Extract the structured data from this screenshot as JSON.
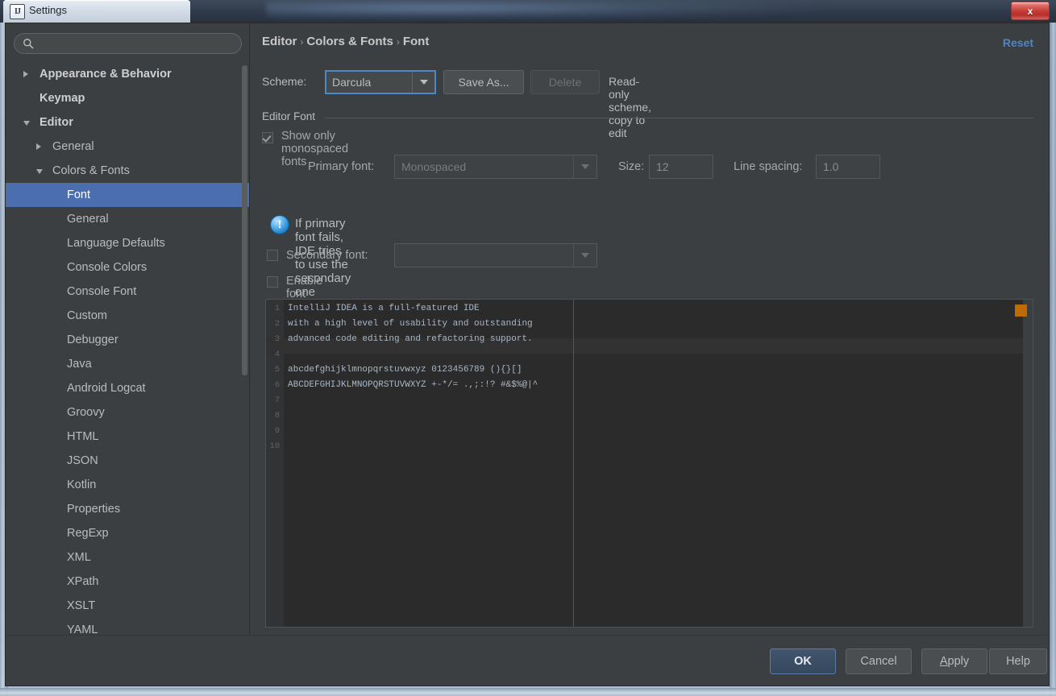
{
  "window": {
    "title": "Settings",
    "app_icon": "intellij-idea-icon",
    "close_label": "x"
  },
  "sidebar": {
    "search": {
      "value": "",
      "placeholder": ""
    },
    "items": [
      {
        "label": "Appearance & Behavior",
        "level": 0,
        "arrow": "collapsed",
        "bold": true,
        "selected": false
      },
      {
        "label": "Keymap",
        "level": 0,
        "arrow": "none",
        "bold": true,
        "selected": false
      },
      {
        "label": "Editor",
        "level": 0,
        "arrow": "expanded",
        "bold": true,
        "selected": false
      },
      {
        "label": "General",
        "level": 1,
        "arrow": "collapsed",
        "bold": false,
        "selected": false
      },
      {
        "label": "Colors & Fonts",
        "level": 1,
        "arrow": "expanded",
        "bold": false,
        "selected": false
      },
      {
        "label": "Font",
        "level": 2,
        "arrow": "none",
        "bold": false,
        "selected": true
      },
      {
        "label": "General",
        "level": 2,
        "arrow": "none",
        "bold": false,
        "selected": false
      },
      {
        "label": "Language Defaults",
        "level": 2,
        "arrow": "none",
        "bold": false,
        "selected": false
      },
      {
        "label": "Console Colors",
        "level": 2,
        "arrow": "none",
        "bold": false,
        "selected": false
      },
      {
        "label": "Console Font",
        "level": 2,
        "arrow": "none",
        "bold": false,
        "selected": false
      },
      {
        "label": "Custom",
        "level": 2,
        "arrow": "none",
        "bold": false,
        "selected": false
      },
      {
        "label": "Debugger",
        "level": 2,
        "arrow": "none",
        "bold": false,
        "selected": false
      },
      {
        "label": "Java",
        "level": 2,
        "arrow": "none",
        "bold": false,
        "selected": false
      },
      {
        "label": "Android Logcat",
        "level": 2,
        "arrow": "none",
        "bold": false,
        "selected": false
      },
      {
        "label": "Groovy",
        "level": 2,
        "arrow": "none",
        "bold": false,
        "selected": false
      },
      {
        "label": "HTML",
        "level": 2,
        "arrow": "none",
        "bold": false,
        "selected": false
      },
      {
        "label": "JSON",
        "level": 2,
        "arrow": "none",
        "bold": false,
        "selected": false
      },
      {
        "label": "Kotlin",
        "level": 2,
        "arrow": "none",
        "bold": false,
        "selected": false
      },
      {
        "label": "Properties",
        "level": 2,
        "arrow": "none",
        "bold": false,
        "selected": false
      },
      {
        "label": "RegExp",
        "level": 2,
        "arrow": "none",
        "bold": false,
        "selected": false
      },
      {
        "label": "XML",
        "level": 2,
        "arrow": "none",
        "bold": false,
        "selected": false
      },
      {
        "label": "XPath",
        "level": 2,
        "arrow": "none",
        "bold": false,
        "selected": false
      },
      {
        "label": "XSLT",
        "level": 2,
        "arrow": "none",
        "bold": false,
        "selected": false
      },
      {
        "label": "YAML",
        "level": 2,
        "arrow": "none",
        "bold": false,
        "selected": false
      }
    ]
  },
  "header": {
    "breadcrumb": [
      "Editor",
      "Colors & Fonts",
      "Font"
    ],
    "separator": "›",
    "reset_label": "Reset"
  },
  "scheme": {
    "label": "Scheme:",
    "value": "Darcula",
    "save_as_label": "Save As...",
    "delete_label": "Delete",
    "readonly_note": "Read-only scheme, copy to edit"
  },
  "editor_font": {
    "group_title": "Editor Font",
    "monospaced_label": "Show only monospaced fonts",
    "monospaced_checked": true,
    "primary_font_label": "Primary font:",
    "primary_font_value": "Monospaced",
    "size_label": "Size:",
    "size_value": "12",
    "line_spacing_label": "Line spacing:",
    "line_spacing_value": "1.0",
    "info_icon": "info-exclamation-icon",
    "info_text": "If primary font fails, IDE tries to use the secondary one",
    "secondary_font_label": "Secondary font:",
    "secondary_font_value": "",
    "secondary_checked": false,
    "ligatures_label": "Enable font ligatures more info",
    "ligatures_checked": false
  },
  "preview": {
    "caret_line": 4,
    "marker_color": "#bf6b04",
    "lines": [
      {
        "n": "1",
        "text": "IntelliJ IDEA is a full-featured IDE"
      },
      {
        "n": "2",
        "text": "with a high level of usability and outstanding"
      },
      {
        "n": "3",
        "text": "advanced code editing and refactoring support."
      },
      {
        "n": "4",
        "text": ""
      },
      {
        "n": "5",
        "text": "abcdefghijklmnopqrstuvwxyz 0123456789 (){}[]"
      },
      {
        "n": "6",
        "text": "ABCDEFGHIJKLMNOPQRSTUVWXYZ +-*/= .,;:!? #&$%@|^"
      },
      {
        "n": "7",
        "text": ""
      },
      {
        "n": "8",
        "text": ""
      },
      {
        "n": "9",
        "text": ""
      },
      {
        "n": "10",
        "text": ""
      }
    ]
  },
  "footer": {
    "ok_label": "OK",
    "cancel_label": "Cancel",
    "apply_label": "Apply",
    "apply_mnemonic": "A",
    "apply_rest": "pply",
    "help_label": "Help"
  },
  "colors": {
    "accent_selection": "#4b6eaf",
    "link": "#4a86c8",
    "panel_bg": "#3c3f41",
    "editor_bg": "#2b2b2b",
    "editor_text": "#a9b7c6",
    "marker": "#bf6b04"
  }
}
